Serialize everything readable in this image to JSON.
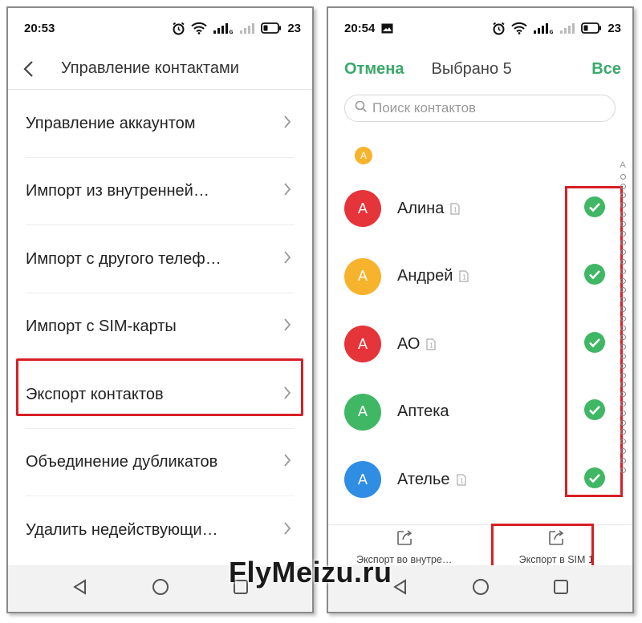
{
  "left": {
    "status": {
      "time": "20:53",
      "battery": "23"
    },
    "header": {
      "title": "Управление контактами"
    },
    "menu": [
      {
        "label": "Управление аккаунтом"
      },
      {
        "label": "Импорт из внутренней…"
      },
      {
        "label": "Импорт с другого телеф…"
      },
      {
        "label": "Импорт с SIM-карты"
      },
      {
        "label": "Экспорт контактов"
      },
      {
        "label": "Объединение дубликатов"
      },
      {
        "label": "Удалить недействующи…"
      }
    ]
  },
  "right": {
    "status": {
      "time": "20:54",
      "battery": "23"
    },
    "header": {
      "cancel": "Отмена",
      "selected": "Выбрано 5",
      "all": "Все"
    },
    "search": {
      "placeholder": "Поиск контактов"
    },
    "section_letter": "А",
    "contacts": [
      {
        "initial": "А",
        "name": "Алина",
        "color": "#e5343a"
      },
      {
        "initial": "А",
        "name": "Андрей",
        "color": "#f7b32b"
      },
      {
        "initial": "А",
        "name": "АО",
        "color": "#e5343a"
      },
      {
        "initial": "А",
        "name": "Аптека",
        "color": "#3fb765"
      },
      {
        "initial": "А",
        "name": "Ателье",
        "color": "#2f8de4"
      }
    ],
    "index_top": "A",
    "actions": [
      {
        "label": "Экспорт во внутре…"
      },
      {
        "label": "Экспорт в SIM 1"
      }
    ]
  },
  "colors": {
    "accent": "#3aa86a",
    "highlight": "#d71f26",
    "check": "#3fb765"
  },
  "watermark": "FlyMeizu.ru"
}
